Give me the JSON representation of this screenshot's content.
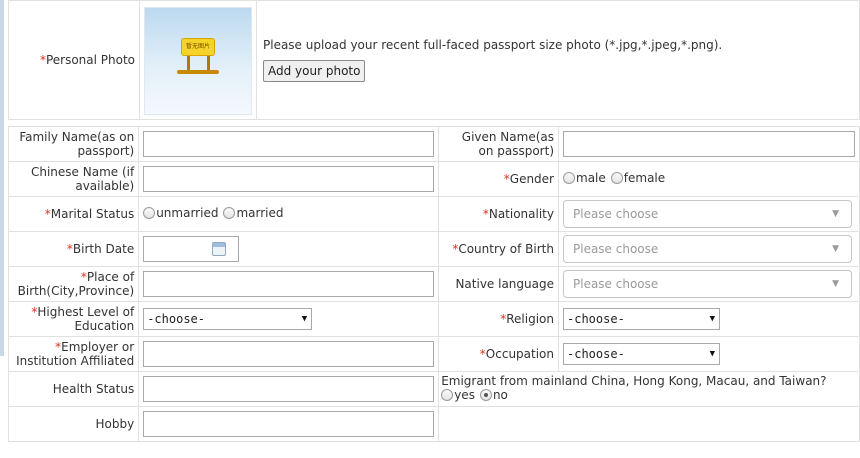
{
  "photo": {
    "label": "Personal Photo",
    "sign_text": "暂无图片",
    "tip": "Please upload your recent full-faced passport size photo (*.jpg,*.jpeg,*.png).",
    "button": "Add your photo"
  },
  "form": {
    "family_name": {
      "label": "Family Name(as on passport)",
      "value": ""
    },
    "given_name": {
      "label": "Given Name(as on passport)",
      "value": ""
    },
    "chinese_name": {
      "label": "Chinese Name (if available)",
      "value": ""
    },
    "gender": {
      "label": "Gender",
      "options": [
        "male",
        "female"
      ],
      "selected": null
    },
    "marital_status": {
      "label": "Marital Status",
      "options": [
        "unmarried",
        "married"
      ],
      "selected": null
    },
    "nationality": {
      "label": "Nationality",
      "placeholder": "Please choose"
    },
    "birth_date": {
      "label": "Birth Date",
      "value": ""
    },
    "country_of_birth": {
      "label": "Country of Birth",
      "placeholder": "Please choose"
    },
    "place_of_birth": {
      "label": "Place of Birth(City,Province)",
      "value": ""
    },
    "native_language": {
      "label": "Native language",
      "placeholder": "Please choose"
    },
    "education": {
      "label": "Highest Level of Education",
      "value": "-choose-"
    },
    "religion": {
      "label": "Religion",
      "value": "-choose-"
    },
    "employer": {
      "label": "Employer or Institution Affiliated",
      "value": ""
    },
    "occupation": {
      "label": "Occupation",
      "value": "-choose-"
    },
    "health_status": {
      "label": "Health Status",
      "value": ""
    },
    "emigrant": {
      "question": "Emigrant from mainland China, Hong Kong, Macau, and Taiwan?",
      "options": [
        "yes",
        "no"
      ],
      "selected": "no"
    },
    "hobby": {
      "label": "Hobby",
      "value": ""
    }
  },
  "icons": {
    "calendar": "calendar-icon",
    "dropdown": "chevron-down-icon"
  },
  "colors": {
    "required": "#e0301e",
    "border": "#e1e1e1"
  }
}
